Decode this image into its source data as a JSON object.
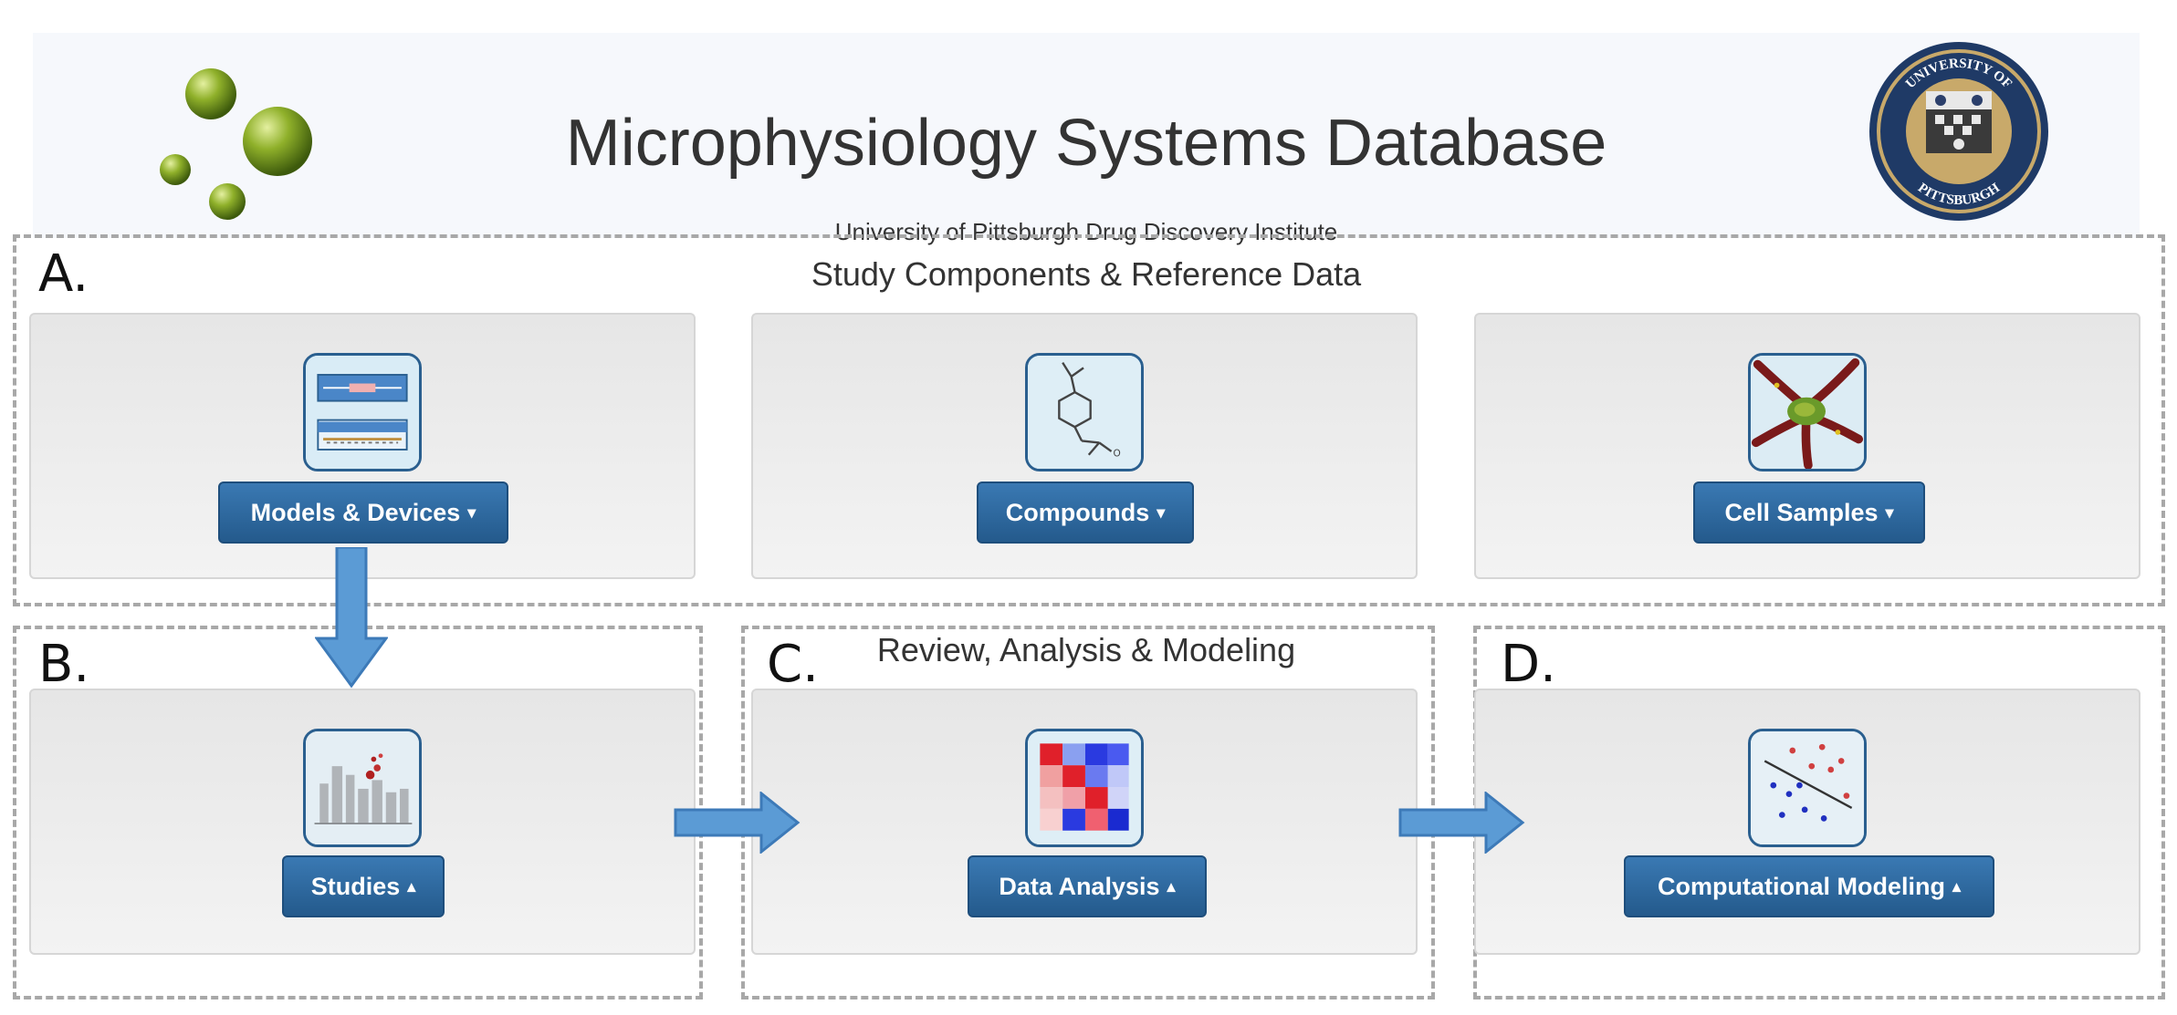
{
  "header": {
    "title": "Microphysiology Systems Database",
    "subtitle": "University of Pittsburgh Drug Discovery Institute"
  },
  "sections": {
    "a_label": "A.",
    "b_label": "B.",
    "c_label": "C.",
    "d_label": "D.",
    "a_title": "Study Components & Reference Data",
    "c_title": "Review, Analysis & Modeling"
  },
  "buttons": {
    "models": "Models & Devices",
    "compounds": "Compounds",
    "cells": "Cell Samples",
    "studies": "Studies",
    "analysis": "Data Analysis",
    "modeling": "Computational Modeling"
  },
  "carets": {
    "down": "▾",
    "up": "▴"
  },
  "icons": {
    "logo": "green-spheres-logo",
    "seal": "university-of-pittsburgh-seal",
    "models": "device-schematic-icon",
    "compounds": "chemical-structure-icon",
    "cells": "cell-sample-icon",
    "studies": "bar-chart-icon",
    "analysis": "heatmap-icon",
    "modeling": "scatter-regression-icon"
  },
  "colors": {
    "button": "#2d6aa3",
    "arrow": "#5b9bd5",
    "dash": "#a8a8a8"
  },
  "seal_text": {
    "top": "UNIVERSITY OF",
    "bottom": "PITTSBURGH"
  }
}
